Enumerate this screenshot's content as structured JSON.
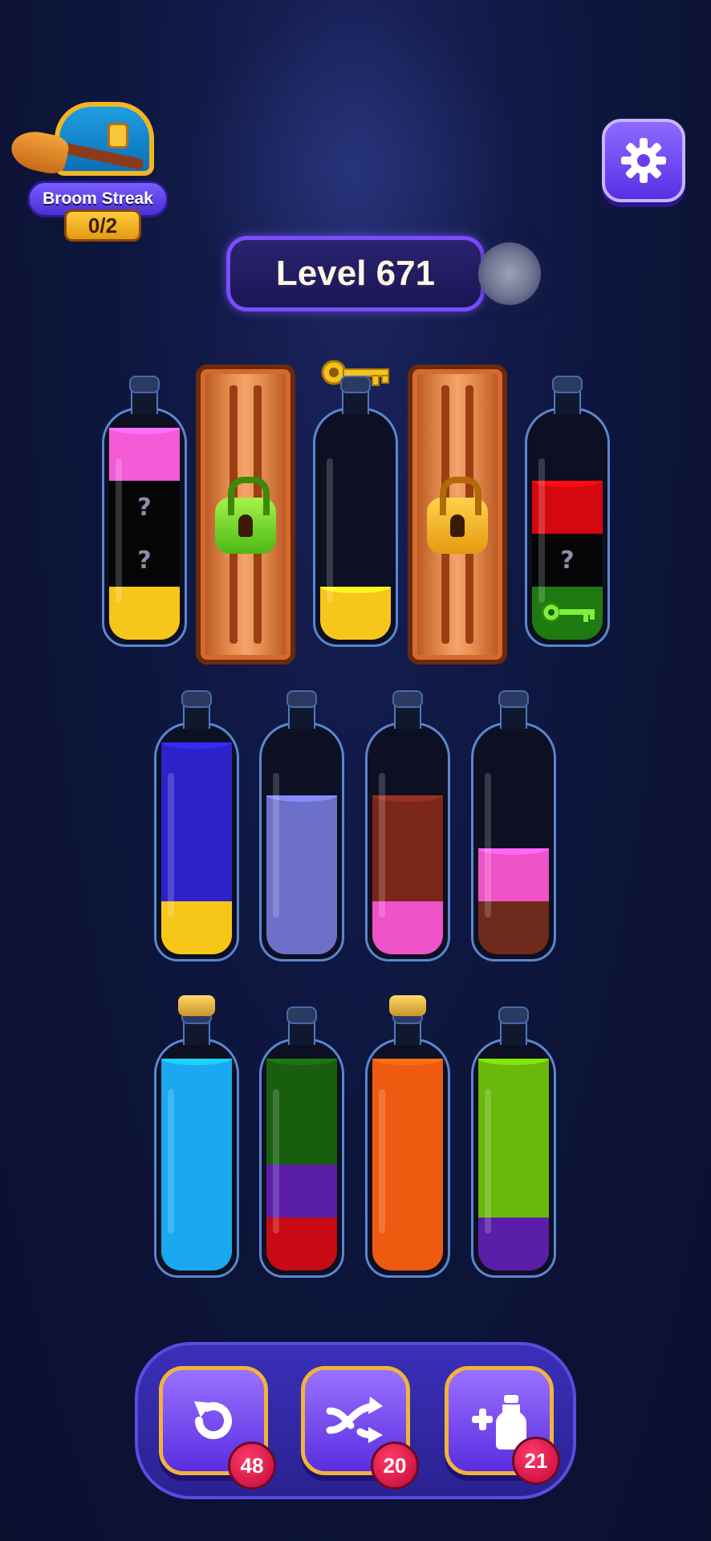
{
  "streak": {
    "label": "Broom Streak",
    "count": "0/2"
  },
  "level": {
    "label": "Level 671"
  },
  "mystery_mark": "?",
  "colors": {
    "pink": "#f25ad6",
    "yellow": "#f7c61a",
    "red": "#d4080e",
    "green": "#1f7a12",
    "blue": "#2b22c8",
    "lavender": "#6d70c8",
    "maroon": "#7a261a",
    "hotpink": "#f052c8",
    "brown": "#6e2a1c",
    "cyan": "#1aa8f0",
    "dkgreen": "#185e0e",
    "purple": "#5a1ea8",
    "crimson": "#c80a14",
    "orange": "#ee5a10",
    "lime": "#6ab80a"
  },
  "bottles_row1": [
    {
      "layers": [
        "yellow",
        "mystery",
        "mystery",
        "pink"
      ]
    },
    {
      "locked": true,
      "lock_color": "green"
    },
    {
      "layers": [
        "yellow"
      ],
      "key_cap": true
    },
    {
      "locked": true,
      "lock_color": "gold"
    },
    {
      "layers": [
        "green",
        "mystery",
        "red"
      ],
      "key_in_layer": true
    }
  ],
  "bottles_row2": [
    {
      "layers": [
        "yellow",
        "blue",
        "blue",
        "blue"
      ]
    },
    {
      "layers": [
        "lavender",
        "lavender",
        "lavender"
      ]
    },
    {
      "layers": [
        "hotpink",
        "maroon",
        "maroon"
      ]
    },
    {
      "layers": [
        "brown",
        "hotpink"
      ]
    }
  ],
  "bottles_row3": [
    {
      "layers": [
        "cyan",
        "cyan",
        "cyan",
        "cyan"
      ],
      "corked": true
    },
    {
      "layers": [
        "crimson",
        "purple",
        "dkgreen",
        "dkgreen"
      ]
    },
    {
      "layers": [
        "orange",
        "orange",
        "orange",
        "orange"
      ],
      "corked": true
    },
    {
      "layers": [
        "purple",
        "lime",
        "lime",
        "lime"
      ]
    }
  ],
  "powerups": {
    "undo": {
      "icon": "undo-icon",
      "count": "48"
    },
    "shuffle": {
      "icon": "shuffle-icon",
      "count": "20"
    },
    "add_bottle": {
      "icon": "add-bottle-icon",
      "count": "21"
    }
  }
}
